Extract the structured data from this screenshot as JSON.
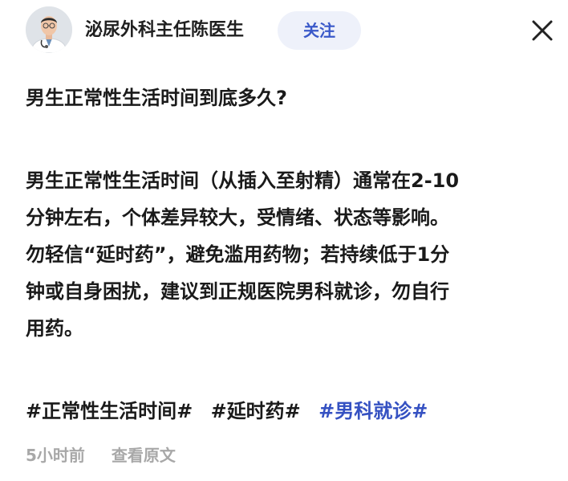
{
  "header": {
    "author_name": "泌尿外科主任陈医生",
    "follow_label": "关注",
    "avatar_icon": "doctor-avatar",
    "close_icon": "close-icon",
    "colors": {
      "follow_bg": "#eef1fa",
      "follow_text": "#3a59c9"
    }
  },
  "post": {
    "question": "男生正常性生活时间到底多久?",
    "answer_lines": [
      "男生正常性生活时间（从插入至射精）通常在2-10",
      "分钟左右，个体差异较大，受情绪、状态等影响。",
      "勿轻信“延时药”，避免滥用药物；若持续低于1分",
      "钟或自身困扰，建议到正规医院男科就诊，勿自行",
      "用药。"
    ],
    "tags": [
      {
        "text": "#正常性生活时间#",
        "link": false
      },
      {
        "text": "#延时药#",
        "link": false
      },
      {
        "text": "#男科就诊#",
        "link": true
      }
    ],
    "tag_link_color": "#3551c2"
  },
  "meta": {
    "time": "5小时前",
    "view_source": "查看原文"
  }
}
